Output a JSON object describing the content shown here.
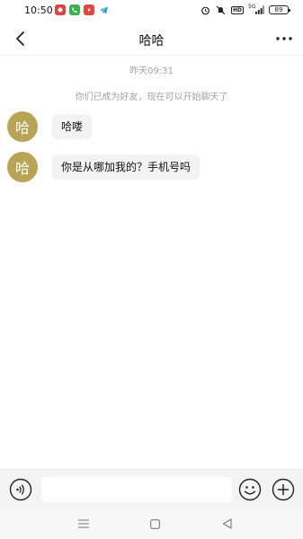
{
  "status_bar": {
    "time": "10:50",
    "network_label": "5G",
    "hd_badge": "HD",
    "battery": "89"
  },
  "header": {
    "title": "哈哈"
  },
  "messages": {
    "timestamp": "昨天09:31",
    "system_note": "你们已成为好友，现在可以开始聊天了",
    "items": [
      {
        "avatar_text": "哈",
        "text": "哈喽"
      },
      {
        "avatar_text": "哈",
        "text": "你是从哪加我的？手机号吗"
      }
    ]
  },
  "input_bar": {
    "value": "",
    "placeholder": ""
  },
  "colors": {
    "avatar": "#b9a456",
    "bubble": "#f3f3f3",
    "hint_text": "#a4a4a4"
  }
}
